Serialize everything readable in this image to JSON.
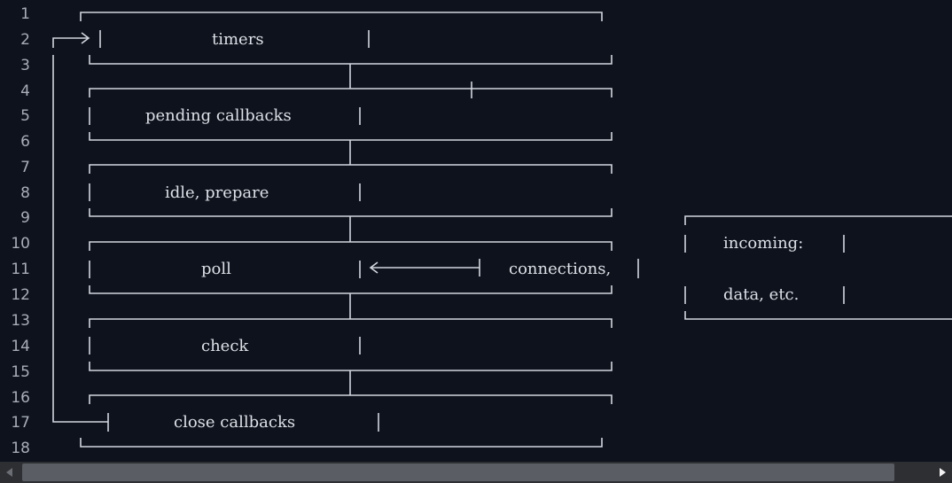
{
  "editor": {
    "line_numbers": [
      "1",
      "2",
      "3",
      "4",
      "5",
      "6",
      "7",
      "8",
      "9",
      "10",
      "11",
      "12",
      "13",
      "14",
      "15",
      "16",
      "17",
      "18"
    ]
  },
  "diagram": {
    "phases": {
      "timers": "timers",
      "pending_callbacks": "pending callbacks",
      "idle_prepare": "idle, prepare",
      "poll": "poll",
      "check": "check",
      "close_callbacks": "close callbacks"
    },
    "incoming": {
      "line1": "incoming:",
      "line2": "connections,",
      "line3": "data, etc."
    }
  },
  "colors": {
    "background": "#0d121c",
    "line_number": "#a8adb8",
    "text": "#dde0e6",
    "scrollbar_track": "#2d2f33",
    "scrollbar_thumb": "#5a5d63"
  },
  "icons": {
    "scroll_left": "triangle-left-icon",
    "scroll_right": "triangle-right-icon"
  }
}
